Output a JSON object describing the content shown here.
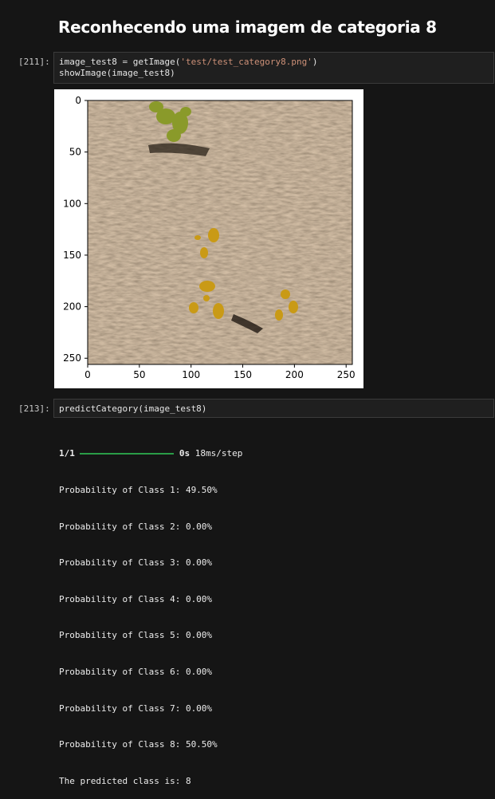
{
  "heading": "Reconhecendo uma imagem de categoria 8",
  "cell1": {
    "prompt": "[211]:",
    "line1_var": "image_test8",
    "line1_op": " = ",
    "line1_fn": "getImage(",
    "line1_str": "'test/test_category8.png'",
    "line1_end": ")",
    "line2": "showImage(image_test8)"
  },
  "plot": {
    "x_ticks": [
      "0",
      "50",
      "100",
      "150",
      "200",
      "250"
    ],
    "y_ticks": [
      "0",
      "50",
      "100",
      "150",
      "200",
      "250"
    ]
  },
  "cell2": {
    "prompt": "[213]:",
    "code": "predictCategory(image_test8)"
  },
  "output": {
    "progress_count": "1/1",
    "progress_time": "0s",
    "progress_step": "18ms/step",
    "lines": [
      "Probability of Class 1: 49.50%",
      "Probability of Class 2: 0.00%",
      "Probability of Class 3: 0.00%",
      "Probability of Class 4: 0.00%",
      "Probability of Class 5: 0.00%",
      "Probability of Class 6: 0.00%",
      "Probability of Class 7: 0.00%",
      "Probability of Class 8: 50.50%",
      "The predicted class is: 8"
    ],
    "progress_fraction": 1.0
  }
}
